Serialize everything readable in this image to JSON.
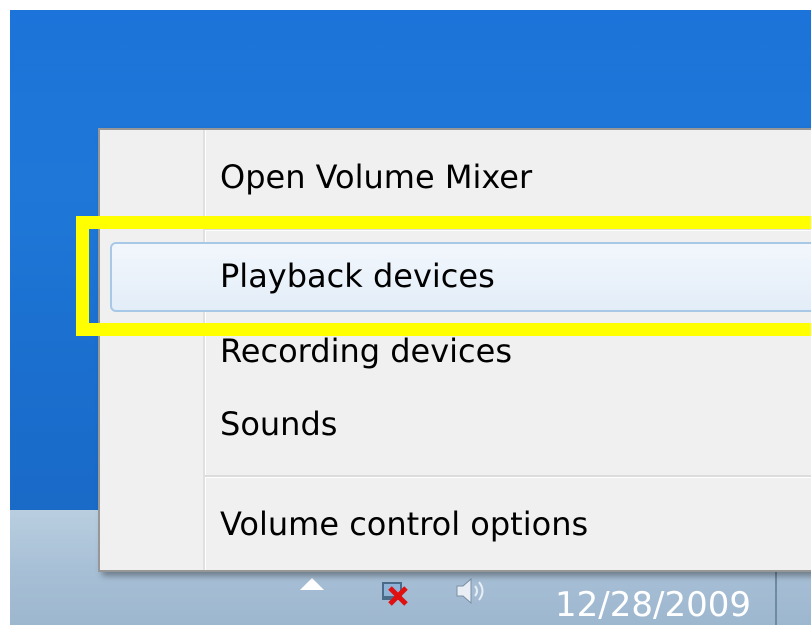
{
  "context_menu": {
    "items": [
      {
        "label": "Open Volume Mixer"
      },
      {
        "label": "Playback devices"
      },
      {
        "label": "Recording devices"
      },
      {
        "label": "Sounds"
      },
      {
        "label": "Volume control options"
      }
    ]
  },
  "taskbar": {
    "clock_date": "12/28/2009"
  },
  "icons": {
    "tray_expand": "up-arrow-icon",
    "network": "network-error-icon",
    "volume": "speaker-icon"
  },
  "colors": {
    "highlight_annotation": "#ffff00",
    "desktop": "#1c73d9",
    "menu_background": "#f0f0f0",
    "hover_border": "#a8c8e8"
  }
}
